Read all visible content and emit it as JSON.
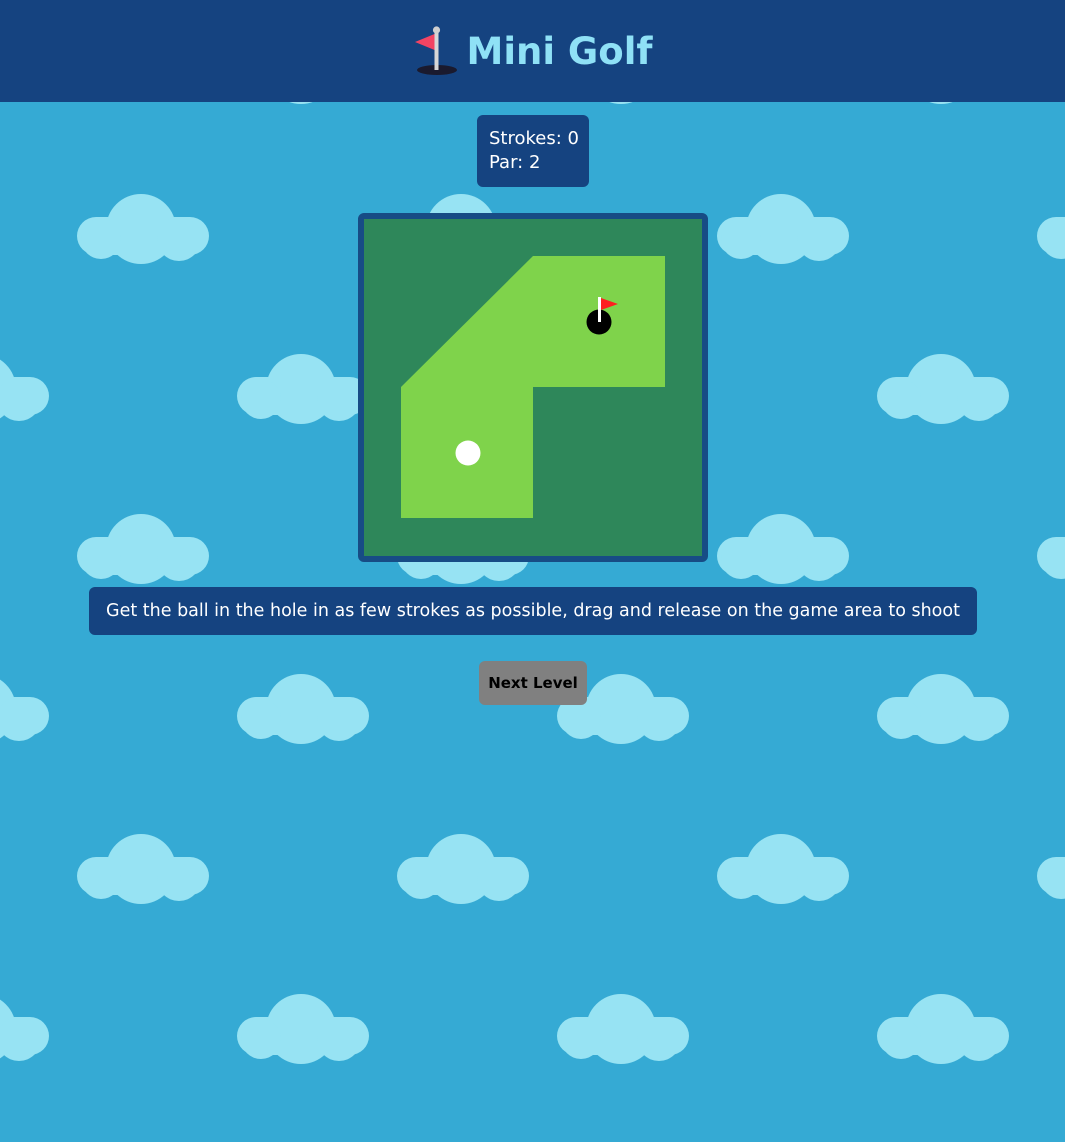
{
  "header": {
    "title": "Mini Golf",
    "icon": "flag-in-hole-icon"
  },
  "score": {
    "strokes_label": "Strokes: 0",
    "par_label": "Par: 2"
  },
  "instructions": "Get the ball in the hole in as few strokes as possible, drag and release on the game area to shoot",
  "next_button_label": "Next Level",
  "colors": {
    "sky": "#35aad4",
    "cloud": "#97e3f3",
    "header": "#154380",
    "title": "#8fe1f6",
    "rough": "#2e875a",
    "fairway": "#7fd34b",
    "border": "#174c85",
    "button": "#808080",
    "flag": "#ff1f1f"
  }
}
